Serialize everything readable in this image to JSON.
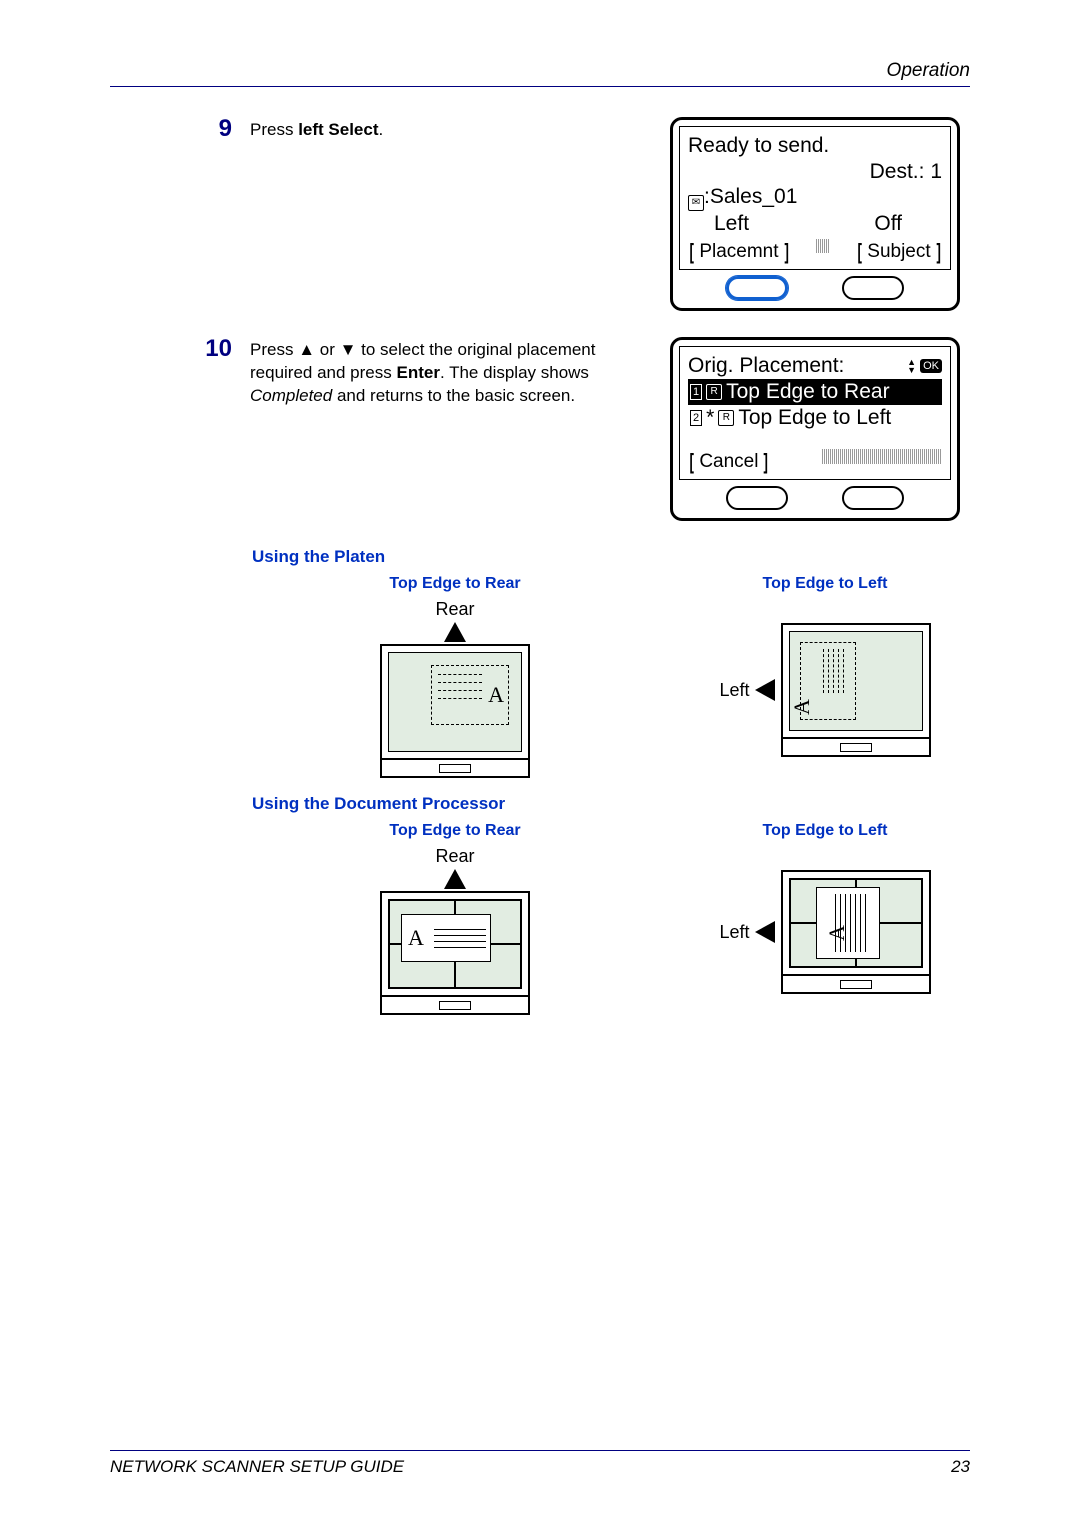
{
  "header": {
    "section": "Operation"
  },
  "steps": {
    "s9": {
      "num": "9",
      "text_a": "Press ",
      "text_b": "left Select",
      "text_c": "."
    },
    "s10": {
      "num": "10",
      "text_a": "Press ",
      "text_b": " or ",
      "text_c": " to select the original placement required and press ",
      "enter": "Enter",
      "text_d": ". The display shows ",
      "completed": "Completed",
      "text_e": " and returns to the basic screen."
    }
  },
  "lcd1": {
    "line1": "Ready to send.",
    "dest_label": "Dest.:",
    "dest_val": "1",
    "contact": ":Sales_01",
    "left": "Left",
    "off": "Off",
    "sk_left": "Placemnt",
    "sk_right": "Subject"
  },
  "lcd2": {
    "title": "Orig. Placement:",
    "opt1_num": "1",
    "opt1": "Top Edge to Rear",
    "opt2_num": "2",
    "opt2": "Top Edge to Left",
    "cancel": "Cancel",
    "ok": "OK"
  },
  "sections": {
    "platen": "Using the Platen",
    "docproc": "Using the Document Processor",
    "rear_title": "Top Edge to Rear",
    "left_title": "Top Edge to Left",
    "rear_label": "Rear",
    "left_label": "Left",
    "a": "A"
  },
  "footer": {
    "left": "NETWORK SCANNER SETUP GUIDE",
    "right": "23"
  }
}
